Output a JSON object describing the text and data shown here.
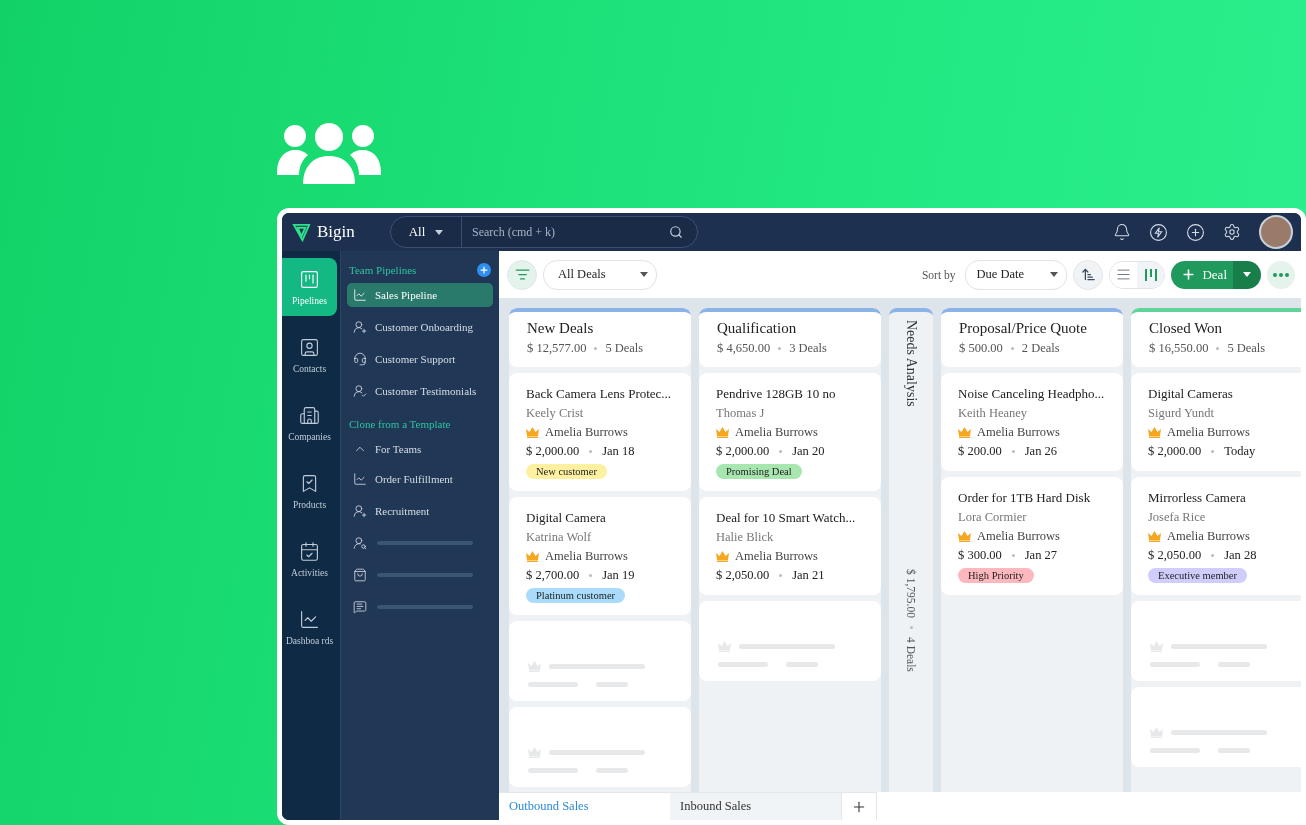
{
  "app": {
    "name": "Bigin",
    "search": {
      "scope": "All",
      "placeholder": "Search (cmd + k)"
    }
  },
  "rail": [
    {
      "label": "Pipelines",
      "selected": true
    },
    {
      "label": "Contacts",
      "selected": false
    },
    {
      "label": "Companies",
      "selected": false
    },
    {
      "label": "Products",
      "selected": false
    },
    {
      "label": "Activities",
      "selected": false
    },
    {
      "label": "Dashboa rds",
      "selected": false
    }
  ],
  "sidebar": {
    "team_heading": "Team Pipelines",
    "pipelines": [
      {
        "label": "Sales Pipeline",
        "selected": true
      },
      {
        "label": "Customer Onboarding",
        "selected": false
      },
      {
        "label": "Customer Support",
        "selected": false
      },
      {
        "label": "Customer Testimonials",
        "selected": false
      }
    ],
    "template_heading": "Clone from a Template",
    "groups": [
      {
        "label": "For Teams",
        "expanded": true,
        "children": [
          {
            "kind": "item",
            "label": "Order Fulfillment"
          },
          {
            "kind": "item",
            "label": "Recruitment"
          },
          {
            "kind": "placeholder"
          },
          {
            "kind": "placeholder"
          },
          {
            "kind": "placeholder"
          }
        ]
      }
    ]
  },
  "toolbar": {
    "view_filter": "All Deals",
    "sort_label": "Sort by",
    "sort_field": "Due Date",
    "views": [
      {
        "kind": "list",
        "selected": false
      },
      {
        "kind": "kanban",
        "selected": true
      }
    ],
    "add_button": "Deal"
  },
  "columns": [
    {
      "kind": "open",
      "title": "New Deals",
      "amount": "$ 12,577.00",
      "count": "5 Deals",
      "color": "#8ab4e8",
      "cards": [
        {
          "kind": "deal",
          "title": "Back Camera Lens Protec...",
          "contact": "Keely Crist",
          "owner": "Amelia Burrows",
          "amount": "$ 2,000.00",
          "date": "Jan 18",
          "tag": {
            "label": "New customer",
            "color": "#fdf0a0"
          }
        },
        {
          "kind": "deal",
          "title": "Digital Camera",
          "contact": "Katrina Wolf",
          "owner": "Amelia Burrows",
          "amount": "$ 2,700.00",
          "date": "Jan 19",
          "tag": {
            "label": "Platinum customer",
            "color": "#a8dcfa"
          }
        },
        {
          "kind": "placeholder"
        },
        {
          "kind": "placeholder"
        }
      ]
    },
    {
      "kind": "open",
      "title": "Qualification",
      "amount": "$ 4,650.00",
      "count": "3 Deals",
      "color": "#8ab4e8",
      "cards": [
        {
          "kind": "deal",
          "title": "Pendrive 128GB 10 no",
          "contact": "Thomas J",
          "owner": "Amelia Burrows",
          "amount": "$ 2,000.00",
          "date": "Jan 20",
          "tag": {
            "label": "Promising Deal",
            "color": "#a8e6b0"
          }
        },
        {
          "kind": "deal",
          "title": "Deal for 10 Smart Watch...",
          "contact": "Halie Blick",
          "owner": "Amelia Burrows",
          "amount": "$ 2,050.00",
          "date": "Jan 21"
        },
        {
          "kind": "placeholder"
        }
      ]
    },
    {
      "kind": "collapsed",
      "title": "Needs Analysis",
      "amount": "$ 1,795.00",
      "count": "4 Deals",
      "color": "#8ab4e8"
    },
    {
      "kind": "open",
      "title": "Proposal/Price Quote",
      "amount": "$ 500.00",
      "count": "2 Deals",
      "color": "#8ab4e8",
      "cards": [
        {
          "kind": "deal",
          "title": "Noise Canceling Headpho...",
          "contact": "Keith Heaney",
          "owner": "Amelia Burrows",
          "amount": "$ 200.00",
          "date": "Jan 26"
        },
        {
          "kind": "deal",
          "title": "Order for 1TB Hard Disk",
          "contact": "Lora Cormier",
          "owner": "Amelia Burrows",
          "amount": "$ 300.00",
          "date": "Jan 27",
          "tag": {
            "label": "High Priority",
            "color": "#fcb8bc"
          }
        }
      ]
    },
    {
      "kind": "open",
      "title": "Closed Won",
      "amount": "$ 16,550.00",
      "count": "5 Deals",
      "color": "#5fd39a",
      "cards": [
        {
          "kind": "deal",
          "title": "Digital Cameras",
          "contact": "Sigurd Yundt",
          "owner": "Amelia Burrows",
          "amount": "$ 2,000.00",
          "date": "Today"
        },
        {
          "kind": "deal",
          "title": "Mirrorless Camera",
          "contact": "Josefa Rice",
          "owner": "Amelia Burrows",
          "amount": "$ 2,050.00",
          "date": "Jan 28",
          "tag": {
            "label": "Executive member",
            "color": "#cfcdfb"
          }
        },
        {
          "kind": "placeholder"
        },
        {
          "kind": "placeholder"
        }
      ]
    }
  ],
  "bottom_tabs": [
    {
      "label": "Outbound Sales",
      "selected": true
    },
    {
      "label": "Inbound Sales",
      "selected": false
    }
  ]
}
